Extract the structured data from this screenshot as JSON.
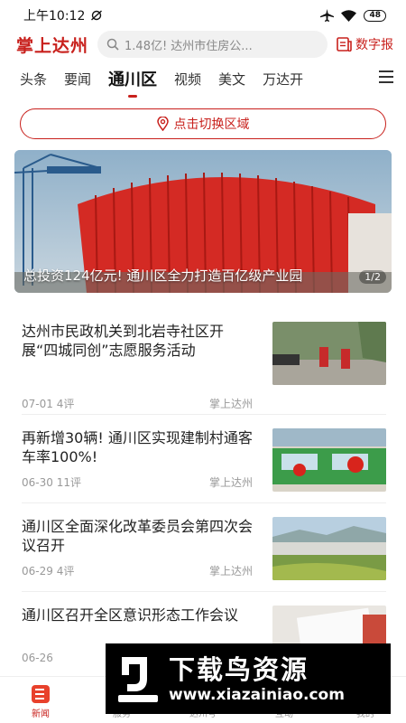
{
  "status": {
    "time": "上午10:12",
    "battery": "48"
  },
  "header": {
    "logo": "掌上达州",
    "search_placeholder": "1.48亿! 达州市住房公...",
    "epaper_label": "数字报"
  },
  "tabs": [
    {
      "label": "头条",
      "active": false
    },
    {
      "label": "要闻",
      "active": false
    },
    {
      "label": "通川区",
      "active": true
    },
    {
      "label": "视频",
      "active": false
    },
    {
      "label": "美文",
      "active": false
    },
    {
      "label": "万达开",
      "active": false
    }
  ],
  "region_button": "点击切换区域",
  "banner": {
    "caption": "总投资124亿元! 通川区全力打造百亿级产业园",
    "pager": "1/2"
  },
  "news": [
    {
      "title": "达州市民政机关到北岩寺社区开展“四城同创”志愿服务活动",
      "date": "07-01",
      "comments": "4评",
      "source": "掌上达州"
    },
    {
      "title": "再新增30辆! 通川区实现建制村通客车率100%!",
      "date": "06-30",
      "comments": "11评",
      "source": "掌上达州"
    },
    {
      "title": "通川区全面深化改革委员会第四次会议召开",
      "date": "06-29",
      "comments": "4评",
      "source": "掌上达州"
    },
    {
      "title": "通川区召开全区意识形态工作会议",
      "date": "06-26",
      "comments": "",
      "source": ""
    }
  ],
  "bottom_nav": [
    {
      "label": "新闻",
      "active": true
    },
    {
      "label": "服务",
      "active": false
    },
    {
      "label": "达州号",
      "active": false
    },
    {
      "label": "互动",
      "active": false
    },
    {
      "label": "我的",
      "active": false
    }
  ],
  "watermark": {
    "main": "下载鸟资源",
    "url": "www.xiazainiao.com"
  },
  "colors": {
    "accent": "#c8201c"
  }
}
